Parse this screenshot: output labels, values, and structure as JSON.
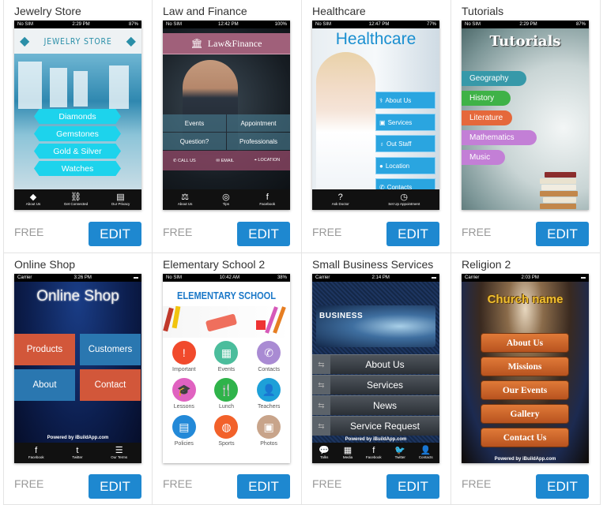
{
  "button_label": "EDIT",
  "price_label": "FREE",
  "templates": [
    {
      "title": "Jewelry Store",
      "status": {
        "left": "No SIM",
        "time": "2:29 PM",
        "right": "87%"
      },
      "header": "JEWELRY STORE",
      "menu": [
        "Diamonds",
        "Gemstones",
        "Gold & Silver",
        "Watches"
      ],
      "tabs": [
        {
          "icon": "diamond-icon",
          "glyph": "◆",
          "label": "About Us"
        },
        {
          "icon": "link-icon",
          "glyph": "⛓",
          "label": "Get Connected"
        },
        {
          "icon": "document-icon",
          "glyph": "▤",
          "label": "Our Privacy"
        }
      ]
    },
    {
      "title": "Law and Finance",
      "status": {
        "left": "No SIM",
        "time": "12:42 PM",
        "right": "100%"
      },
      "header": "Law&Finance",
      "menu": [
        "Events",
        "Appointment",
        "Question?",
        "Professionals"
      ],
      "contact_bar": [
        "CALL US",
        "EMAIL",
        "LOCATION"
      ],
      "tabs": [
        {
          "icon": "gavel-icon",
          "glyph": "⚖",
          "label": "About Us"
        },
        {
          "icon": "coins-icon",
          "glyph": "◎",
          "label": "Tips"
        },
        {
          "icon": "facebook-icon",
          "glyph": "f",
          "label": "Facebook"
        }
      ]
    },
    {
      "title": "Healthcare",
      "status": {
        "left": "No SIM",
        "time": "12:47 PM",
        "right": "77%"
      },
      "header": "Healthcare",
      "menu": [
        "About Us",
        "Services",
        "Out Staff",
        "Location",
        "Contacts"
      ],
      "tabs": [
        {
          "icon": "question-icon",
          "glyph": "?",
          "label": "Ask Doctor"
        },
        {
          "icon": "clock-icon",
          "glyph": "◷",
          "label": "Set Up Appointment"
        }
      ]
    },
    {
      "title": "Tutorials",
      "status": {
        "left": "No SIM",
        "time": "2:29 PM",
        "right": "87%"
      },
      "header": "Tutorials",
      "menu": [
        "Geography",
        "History",
        "Literature",
        "Mathematics",
        "Music"
      ]
    },
    {
      "title": "Online Shop",
      "status": {
        "left": "Carrier",
        "time": "3:26 PM",
        "right": ""
      },
      "header": "Online Shop",
      "menu": [
        "Products",
        "Customers",
        "About",
        "Contact"
      ],
      "powered": "Powered by iBuildApp.com",
      "tabs": [
        {
          "icon": "facebook-icon",
          "glyph": "f",
          "label": "Facebook"
        },
        {
          "icon": "twitter-icon",
          "glyph": "t",
          "label": "Twitter"
        },
        {
          "icon": "list-icon",
          "glyph": "☰",
          "label": "Our Terms"
        }
      ]
    },
    {
      "title": "Elementary School 2",
      "status": {
        "left": "No SIM",
        "time": "10:42 AM",
        "right": "38%"
      },
      "header": "ELEMENTARY SCHOOL",
      "menu": [
        "Important",
        "Events",
        "Contacts",
        "Lessons",
        "Lunch",
        "Teachers",
        "Policies",
        "Sports",
        "Photos"
      ]
    },
    {
      "title": "Small Business Services",
      "status": {
        "left": "Carrier",
        "time": "2:14 PM",
        "right": ""
      },
      "header": "BUSINESS",
      "menu": [
        "About Us",
        "Services",
        "News",
        "Service Request"
      ],
      "powered": "Powered by iBuildApp.com",
      "tabs": [
        {
          "icon": "chat-icon",
          "glyph": "💬",
          "label": "Talks"
        },
        {
          "icon": "film-icon",
          "glyph": "▦",
          "label": "Media"
        },
        {
          "icon": "facebook-icon",
          "glyph": "f",
          "label": "Facebook"
        },
        {
          "icon": "bird-icon",
          "glyph": "🐦",
          "label": "Twitter"
        },
        {
          "icon": "contacts-icon",
          "glyph": "👤",
          "label": "Contacts"
        }
      ]
    },
    {
      "title": "Religion 2",
      "status": {
        "left": "Carrier",
        "time": "2:03 PM",
        "right": ""
      },
      "header": "Church name",
      "menu": [
        "About Us",
        "Missions",
        "Our Events",
        "Gallery",
        "Contact Us"
      ],
      "powered": "Powered by iBuildApp.com"
    }
  ]
}
